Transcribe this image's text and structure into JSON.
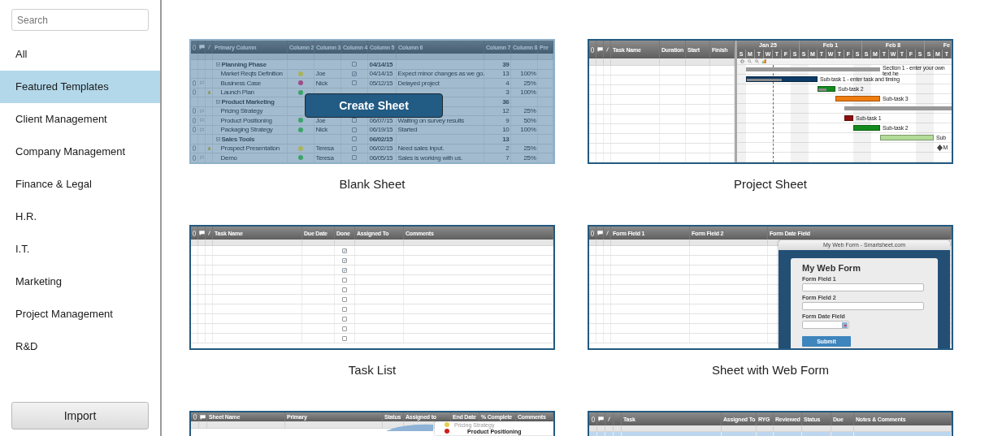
{
  "search": {
    "placeholder": "Search"
  },
  "categories": [
    {
      "label": "All",
      "selected": false
    },
    {
      "label": "Featured Templates",
      "selected": true
    },
    {
      "label": "Client Management",
      "selected": false
    },
    {
      "label": "Company Management",
      "selected": false
    },
    {
      "label": "Finance & Legal",
      "selected": false
    },
    {
      "label": "H.R.",
      "selected": false
    },
    {
      "label": "I.T.",
      "selected": false
    },
    {
      "label": "Marketing",
      "selected": false
    },
    {
      "label": "Project Management",
      "selected": false
    },
    {
      "label": "R&D",
      "selected": false
    }
  ],
  "import_button": "Import",
  "templates": [
    {
      "kind": "project-grid",
      "name": "Blank Sheet",
      "hovered": true,
      "action": "Create Sheet",
      "columns": [
        "Primary Column",
        "Column 2",
        "Column 3",
        "Column 4",
        "Column 5",
        "Column 6",
        "Column 7",
        "Column 8",
        "Pre"
      ],
      "rows": [
        {
          "kind": "section",
          "name": "Planning Phase",
          "done": false,
          "date": "04/14/15",
          "column_7": "39",
          "attachment": false,
          "comments": false,
          "alert": false
        },
        {
          "kind": "task",
          "name": "Market Reqts Definition",
          "color": "#a9b35a",
          "assigned": "Joe",
          "done": true,
          "date": "04/14/15",
          "comment": "Expect minor changes as we go.",
          "column_7": "13",
          "column_8": "100%",
          "attachment": false,
          "comments": false,
          "alert": false
        },
        {
          "kind": "task",
          "name": "Business Case",
          "color": "#9c4d8a",
          "assigned": "Nick",
          "done": false,
          "date": "05/12/15",
          "comment": "Delayed project",
          "column_7": "4",
          "column_8": "25%",
          "attachment": true,
          "comments": true,
          "alert": false
        },
        {
          "kind": "task",
          "name": "Launch Plan",
          "color": "#3da36b",
          "column_7": "3",
          "column_8": "100%",
          "attachment": true,
          "comments": false,
          "alert": true
        },
        {
          "kind": "section",
          "name": "Product Marketing",
          "column_7": "36",
          "attachment": false,
          "comments": false,
          "alert": false
        },
        {
          "kind": "task",
          "name": "Pricing Strategy",
          "column_7": "12",
          "column_8": "25%",
          "attachment": true,
          "comments": true,
          "alert": false
        },
        {
          "kind": "task",
          "name": "Product Positioning",
          "color": "#3da36b",
          "assigned": "Joe",
          "done": false,
          "date": "06/07/15",
          "comment": "Waiting on survey results",
          "column_7": "9",
          "column_8": "50%",
          "attachment": true,
          "comments": true,
          "alert": false
        },
        {
          "kind": "task",
          "name": "Packaging Strategy",
          "color": "#3da36b",
          "assigned": "Nick",
          "done": false,
          "date": "06/19/15",
          "comment": "Started",
          "column_7": "10",
          "column_8": "100%",
          "attachment": true,
          "comments": true,
          "alert": false
        },
        {
          "kind": "section",
          "name": "Sales Tools",
          "done": false,
          "date": "06/02/15",
          "column_7": "13",
          "attachment": false,
          "comments": false,
          "alert": false
        },
        {
          "kind": "task",
          "name": "Prospect Presentation",
          "color": "#a9b35a",
          "assigned": "Teresa",
          "done": false,
          "date": "06/02/15",
          "comment": "Need sales input.",
          "column_7": "2",
          "column_8": "25%",
          "attachment": true,
          "comments": false,
          "alert": true
        },
        {
          "kind": "task",
          "name": "Demo",
          "color": "#3da36b",
          "assigned": "Teresa",
          "done": false,
          "date": "06/05/15",
          "comment": "Sales is working with us.",
          "column_7": "7",
          "column_8": "25%",
          "attachment": true,
          "comments": true,
          "alert": false
        }
      ]
    },
    {
      "kind": "gantt",
      "name": "Project Sheet",
      "hovered": false,
      "columns": [
        "Task Name",
        "Duration",
        "Start",
        "Finish"
      ],
      "weeks": [
        "Jan 25",
        "Feb 1",
        "Feb 8",
        "Fe"
      ],
      "days": [
        "S",
        "M",
        "T",
        "W",
        "T",
        "F",
        "S",
        "S",
        "M",
        "T",
        "W",
        "T",
        "F",
        "S",
        "S",
        "M",
        "T",
        "W",
        "T",
        "F",
        "S",
        "S",
        "M",
        "T"
      ],
      "bars": [
        {
          "kind": "section",
          "label": "Section 1 - enter your own text he",
          "color": "#999999"
        },
        {
          "kind": "task",
          "label": "Sub-task 1 - enter task and timing",
          "color": "#0d3a66",
          "level": 0.5
        },
        {
          "kind": "task",
          "label": "Sub-task 2",
          "color": "#138a1e",
          "level": 0.5
        },
        {
          "kind": "task",
          "label": "Sub-task 3",
          "color": "#f07c10"
        },
        {
          "kind": "section",
          "color": "#999999"
        },
        {
          "kind": "task",
          "label": "Sub-task 1",
          "color": "#8e0f0f"
        },
        {
          "kind": "task",
          "label": "Sub-task 2",
          "color": "#138a1e"
        },
        {
          "kind": "task",
          "label": "Sub",
          "color": "#b2dc98"
        },
        {
          "kind": "milestone",
          "label": "M",
          "color": "#444444"
        }
      ]
    },
    {
      "kind": "task-list",
      "name": "Task List",
      "hovered": false,
      "columns": [
        "Task Name",
        "Due Date",
        "Done",
        "Assigned To",
        "Comments"
      ],
      "rows": [
        {
          "done": true
        },
        {
          "done": true
        },
        {
          "done": true
        },
        {
          "done": false
        },
        {
          "done": false
        },
        {
          "done": false
        },
        {
          "done": false
        },
        {
          "done": false
        },
        {
          "done": false
        },
        {
          "done": false
        }
      ]
    },
    {
      "kind": "web-form",
      "name": "Sheet with Web Form",
      "hovered": false,
      "columns": [
        "Form Field 1",
        "Form Field 2",
        "Form Date Field"
      ],
      "form": {
        "window_title": "My Web Form - Smartsheet.com",
        "title": "My Web Form",
        "fields": [
          {
            "label": "Form Field 1",
            "kind": "text"
          },
          {
            "label": "Form Field 2",
            "kind": "text"
          },
          {
            "label": "Form Date Field",
            "kind": "date"
          }
        ],
        "submit": "Submit"
      }
    },
    {
      "kind": "sheet-summary",
      "hovered": false,
      "columns": [
        "Sheet Name",
        "Primary",
        "Status",
        "Assigned to",
        "End Date",
        "% Complete",
        "Comments"
      ],
      "popup": {
        "items": [
          {
            "label": "Pricing Strategy",
            "color": "#e8cf4a",
            "selected": false
          },
          {
            "label": "Product Positioning",
            "color": "#d0201c",
            "selected": true
          }
        ]
      }
    },
    {
      "kind": "task-tracker",
      "hovered": false,
      "columns": [
        "Task",
        "Assigned To",
        "RYG",
        "Reviewed",
        "Status",
        "Due",
        "Notes & Comments"
      ],
      "rows": [
        {
          "selected": true
        }
      ]
    }
  ]
}
